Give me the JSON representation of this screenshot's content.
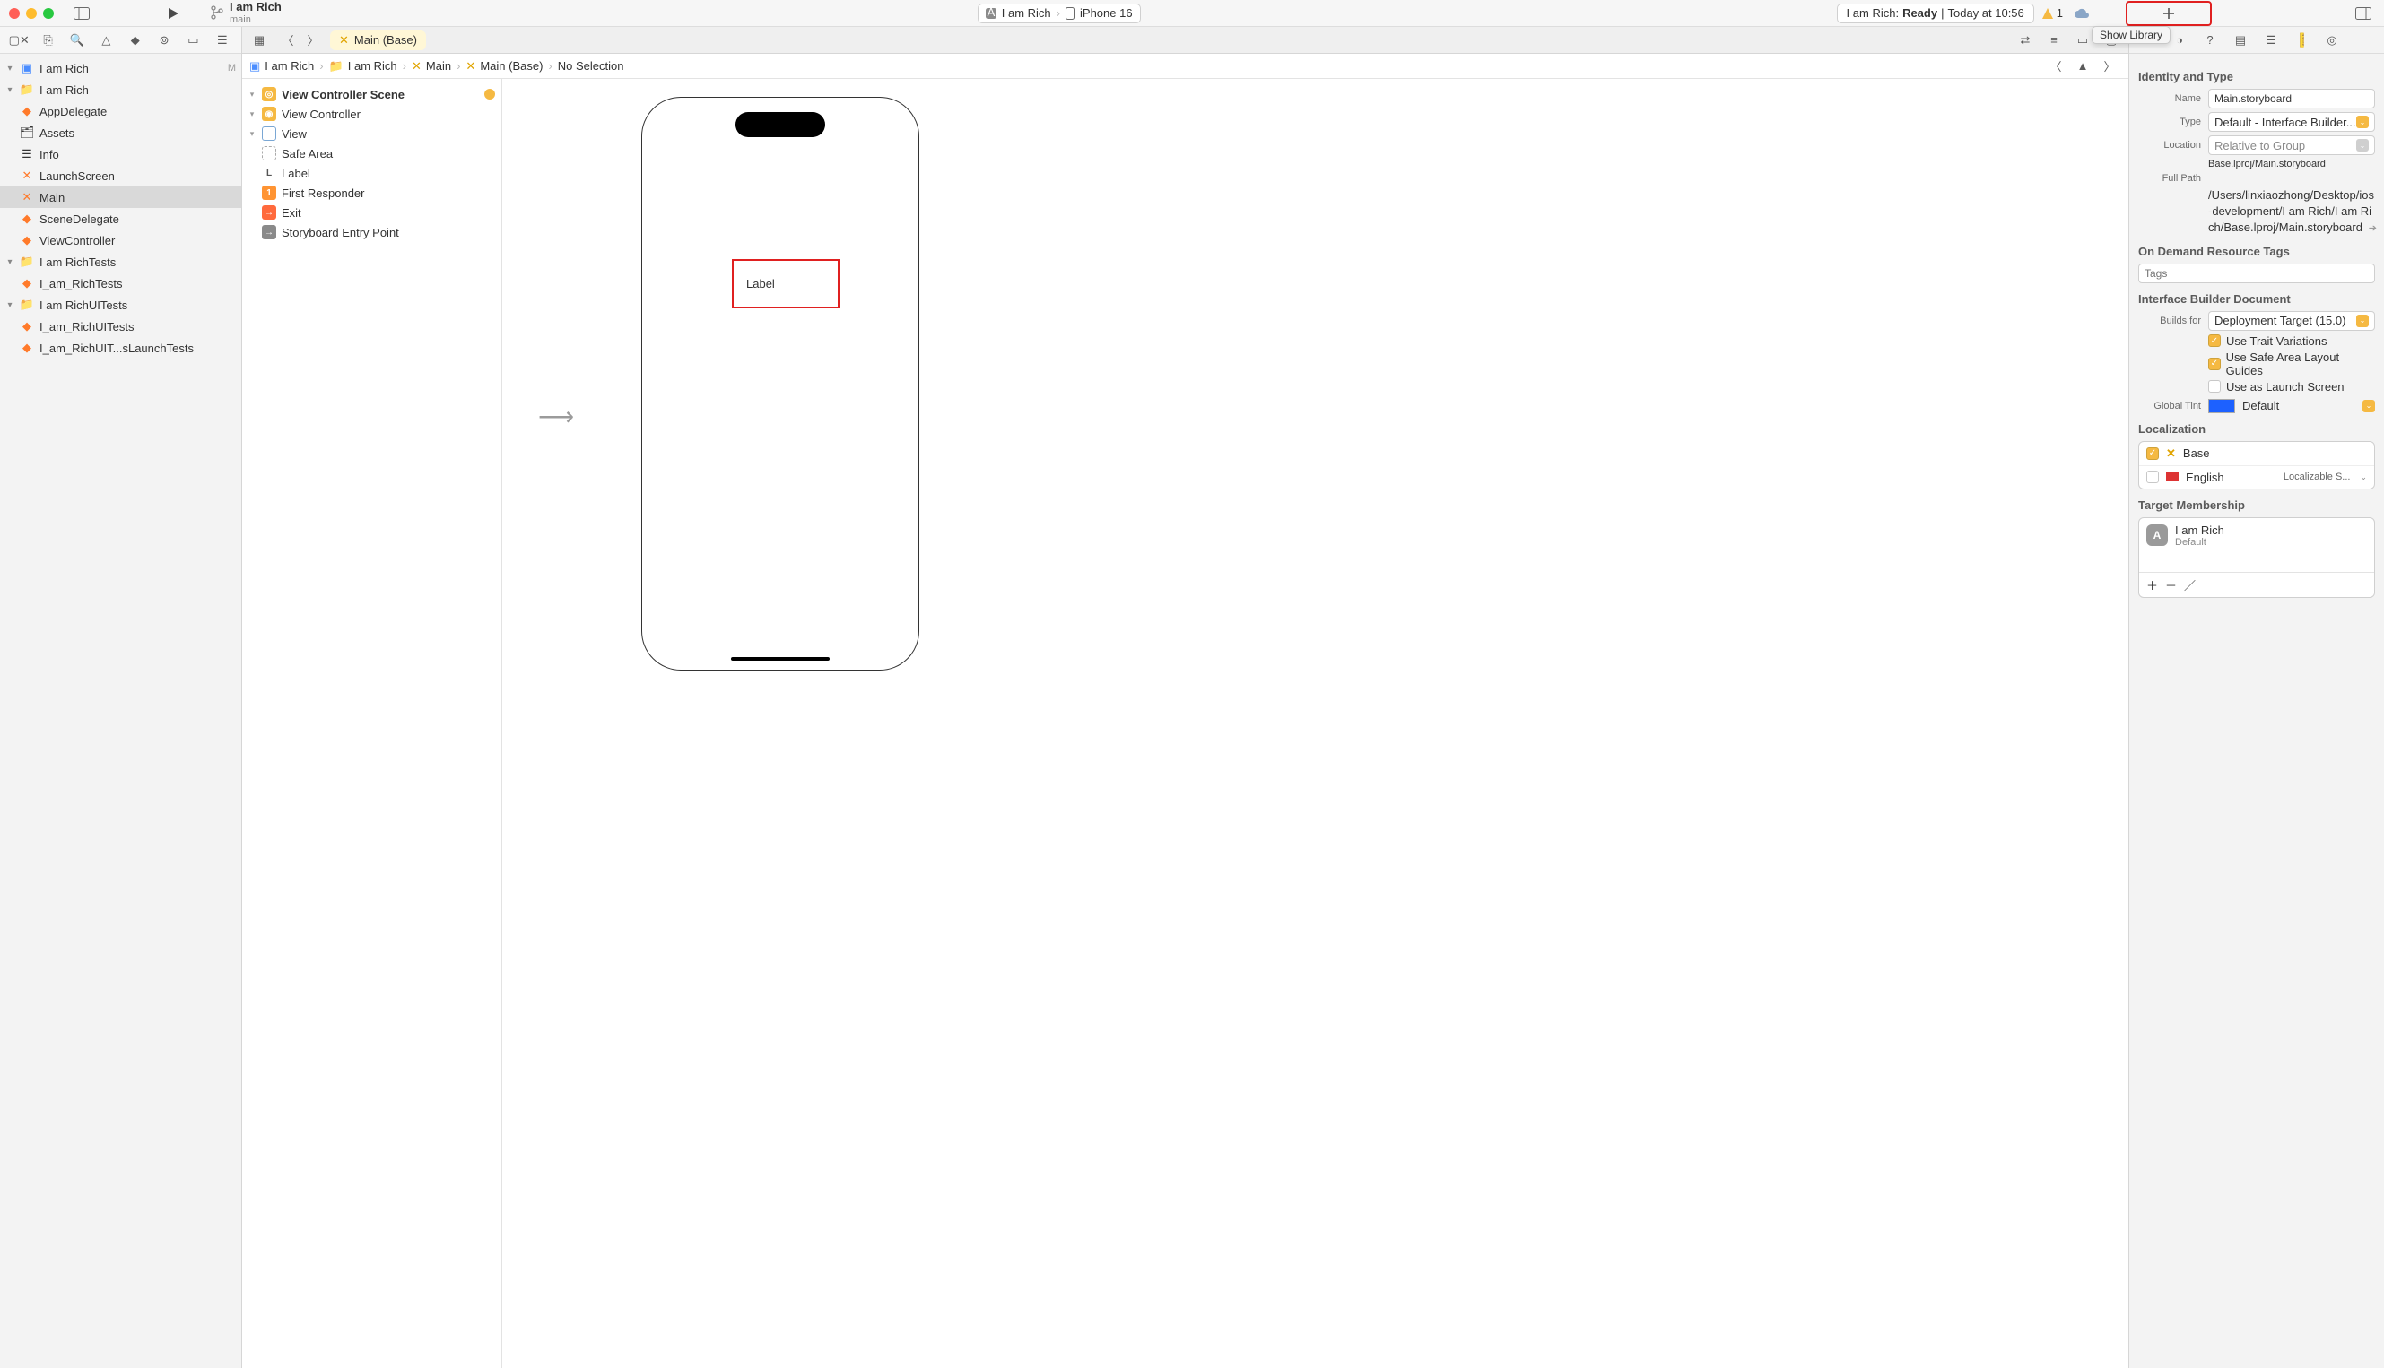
{
  "toolbar": {
    "project_title": "I am Rich",
    "branch": "main",
    "scheme_product": "I am Rich",
    "scheme_device": "iPhone 16",
    "status_prefix": "I am Rich: ",
    "status_state": "Ready",
    "status_separator": " | ",
    "status_time": "Today at 10:56",
    "warning_count": "1",
    "library_tooltip": "Show Library"
  },
  "navigator": {
    "root": "I am Rich",
    "root_badge": "M",
    "folder1": "I am Rich",
    "files1": [
      "AppDelegate",
      "Assets",
      "Info",
      "LaunchScreen",
      "Main",
      "SceneDelegate",
      "ViewController"
    ],
    "folder2": "I am RichTests",
    "files2": [
      "I_am_RichTests"
    ],
    "folder3": "I am RichUITests",
    "files3": [
      "I_am_RichUITests",
      "I_am_RichUIT...sLaunchTests"
    ]
  },
  "tab_label": "Main (Base)",
  "jumpbar": {
    "c0": "I am Rich",
    "c1": "I am Rich",
    "c2": "Main",
    "c3": "Main (Base)",
    "c4": "No Selection"
  },
  "outline": {
    "scene": "View Controller Scene",
    "vc": "View Controller",
    "view": "View",
    "safe": "Safe Area",
    "label": "Label",
    "first": "First Responder",
    "exit": "Exit",
    "entry": "Storyboard Entry Point"
  },
  "canvas": {
    "label_text": "Label"
  },
  "inspector": {
    "section_identity": "Identity and Type",
    "name_label": "Name",
    "name_value": "Main.storyboard",
    "type_label": "Type",
    "type_value": "Default - Interface Builder...",
    "location_label": "Location",
    "location_value": "Relative to Group",
    "location_sub": "Base.lproj/Main.storyboard",
    "fullpath_label": "Full Path",
    "fullpath_value": "/Users/linxiaozhong/Desktop/ios-development/I am Rich/I am Rich/Base.lproj/Main.storyboard",
    "section_odr": "On Demand Resource Tags",
    "odr_placeholder": "Tags",
    "section_ibdoc": "Interface Builder Document",
    "builds_for_label": "Builds for",
    "builds_for_value": "Deployment Target (15.0)",
    "chk_trait": "Use Trait Variations",
    "chk_safe": "Use Safe Area Layout Guides",
    "chk_launch": "Use as Launch Screen",
    "tint_label": "Global Tint",
    "tint_value": "Default",
    "section_loc": "Localization",
    "loc_base": "Base",
    "loc_en": "English",
    "loc_en_right": "Localizable S...",
    "section_tm": "Target Membership",
    "tm_app": "I am Rich",
    "tm_default": "Default"
  }
}
